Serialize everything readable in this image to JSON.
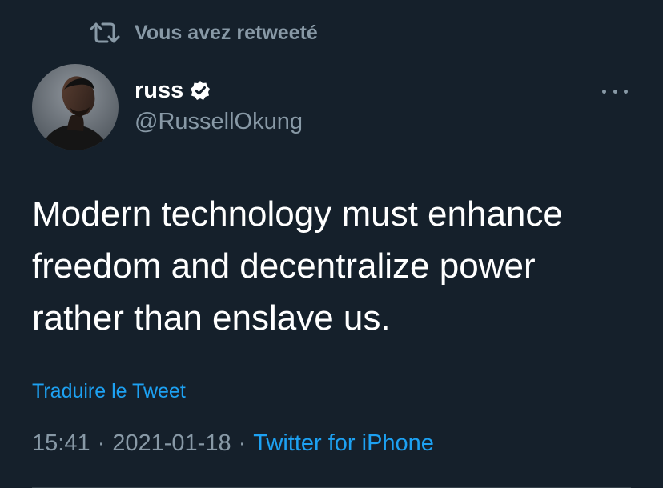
{
  "retweet": {
    "label": "Vous avez retweeté",
    "icon": "retweet-icon"
  },
  "author": {
    "display_name": "russ",
    "verified": true,
    "handle": "@RussellOkung",
    "avatar_icon": "avatar"
  },
  "tweet": {
    "text": "Modern technology must enhance\nfreedom and decentralize power\nrather than enslave us.",
    "translate_label": "Traduire le Tweet"
  },
  "meta": {
    "time": "15:41",
    "separator": "·",
    "date": "2021-01-18",
    "source": "Twitter for iPhone"
  },
  "colors": {
    "background": "#15202b",
    "secondary_text": "#8899a6",
    "link": "#1da1f2",
    "primary_text": "#ffffff"
  }
}
